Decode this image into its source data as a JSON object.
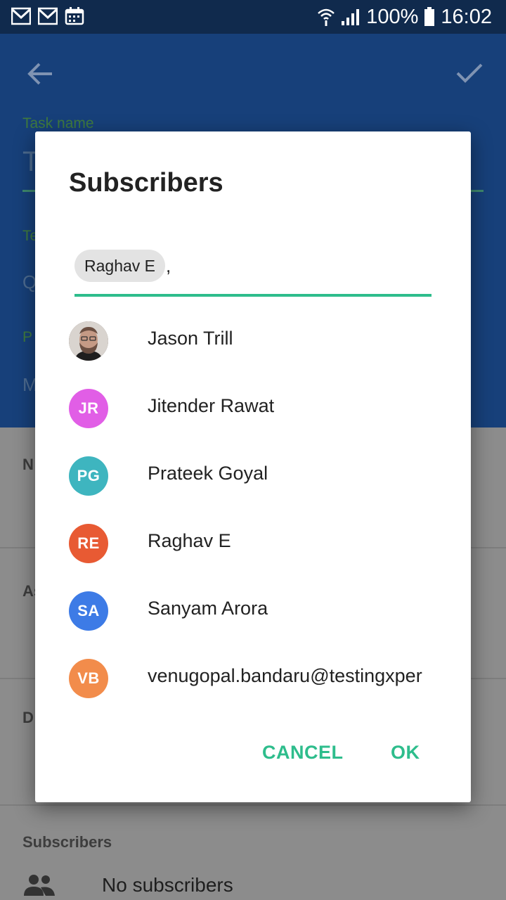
{
  "status_bar": {
    "left_icons": [
      "gmail-icon",
      "gmail-icon",
      "calendar-icon"
    ],
    "right_icons": [
      "wifi-icon",
      "signal-icon",
      "battery-icon"
    ],
    "battery": "100%",
    "time": "16:02"
  },
  "dialog": {
    "title": "Subscribers",
    "selected_chip": "Raghav E",
    "chip_separator": ",",
    "contacts": [
      {
        "initials": "",
        "name": "Jason Trill",
        "color": "#5a4a42",
        "photo": true
      },
      {
        "initials": "JR",
        "name": "Jitender Rawat",
        "color": "#e15ee6"
      },
      {
        "initials": "PG",
        "name": "Prateek Goyal",
        "color": "#3eb5bf"
      },
      {
        "initials": "RE",
        "name": "Raghav E",
        "color": "#e85a33"
      },
      {
        "initials": "SA",
        "name": "Sanyam Arora",
        "color": "#3d7be6"
      },
      {
        "initials": "VB",
        "name": "venugopal.bandaru@testingxper",
        "color": "#f28c4b"
      }
    ],
    "cancel_label": "CANCEL",
    "ok_label": "OK"
  },
  "background": {
    "task_name_label": "Task name",
    "task_name_value": "T",
    "field2_label": "Te",
    "field2_value": "Q",
    "field3_label": "P",
    "field3_value": "M",
    "section1_label": "N",
    "section2_label": "As",
    "section3_label": "D",
    "subscribers_label": "Subscribers",
    "subscribers_value": "No subscribers"
  },
  "colors": {
    "accent": "#2ebd8c",
    "appbar": "#17407a",
    "statusbar": "#102a4d"
  }
}
